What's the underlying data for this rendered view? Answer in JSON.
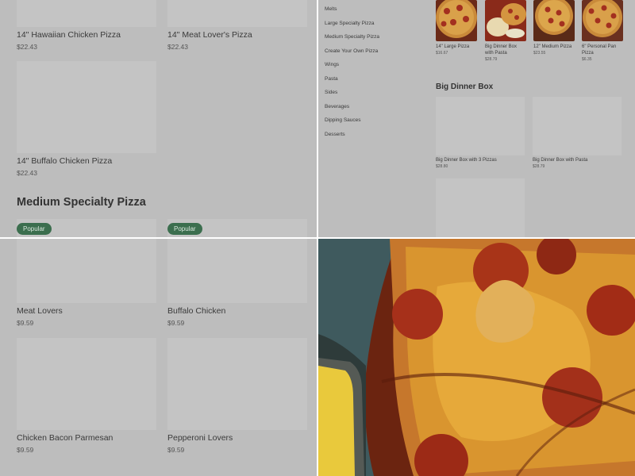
{
  "q1": {
    "cards_top": [
      {
        "name": "14\" Hawaiian Chicken Pizza",
        "price": "$22.43"
      },
      {
        "name": "14\" Meat Lover's Pizza",
        "price": "$22.43"
      }
    ],
    "card_mid": {
      "name": "14\" Buffalo Chicken Pizza",
      "price": "$22.43"
    },
    "section_title": "Medium Specialty Pizza",
    "badges": [
      "Popular",
      "Popular"
    ]
  },
  "q2": {
    "sidebar": [
      "Melts",
      "Large Specialty Pizza",
      "Medium Specialty Pizza",
      "Create Your Own Pizza",
      "Wings",
      "Pasta",
      "Sides",
      "Beverages",
      "Dipping Sauces",
      "Desserts"
    ],
    "thumbs": [
      {
        "name": "14\" Large Pizza",
        "price": "$16.67"
      },
      {
        "name": "Big Dinner Box with Pasta",
        "price": "$28.79"
      },
      {
        "name": "12\" Medium Pizza",
        "price": "$23.55"
      },
      {
        "name": "6\" Personal Pan Pizza",
        "price": "$6.35"
      }
    ],
    "section_title": "Big Dinner Box",
    "boxes": [
      {
        "name": "Big Dinner Box with 3 Pizzas",
        "price": "$28.80"
      },
      {
        "name": "Big Dinner Box with Pasta",
        "price": "$28.79"
      }
    ]
  },
  "q3": {
    "cards": [
      {
        "name": "Meat Lovers",
        "price": "$9.59"
      },
      {
        "name": "Buffalo Chicken",
        "price": "$9.59"
      },
      {
        "name": "Chicken Bacon Parmesan",
        "price": "$9.59"
      },
      {
        "name": "Pepperoni Lovers",
        "price": "$9.59"
      }
    ]
  },
  "colors": {
    "overlay": "#bdbdbd",
    "placeholder": "#c4c4c4",
    "badge": "#3b6e4e",
    "divider": "#ffffff"
  }
}
